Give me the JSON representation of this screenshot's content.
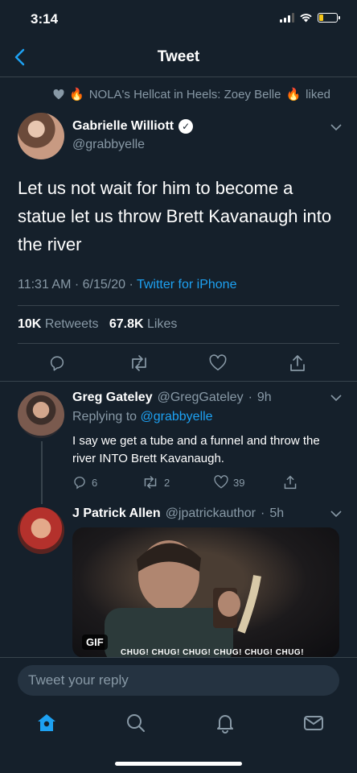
{
  "status_bar": {
    "time": "3:14"
  },
  "nav": {
    "title": "Tweet"
  },
  "liked_by": {
    "name": "NOLA's Hellcat in Heels: Zoey Belle",
    "action": "liked"
  },
  "tweet": {
    "author_name": "Gabrielle Williott",
    "author_handle": "@grabbyelle",
    "text": "Let us not wait for him to become a statue let us throw Brett Kavanaugh into the river",
    "time": "11:31 AM",
    "date": "6/15/20",
    "source": "Twitter for iPhone",
    "retweets_count": "10K",
    "retweets_label": "Retweets",
    "likes_count": "67.8K",
    "likes_label": "Likes"
  },
  "replies": [
    {
      "name": "Greg Gateley",
      "handle": "@GregGateley",
      "age": "9h",
      "replying_to_label": "Replying to",
      "replying_to": "@grabbyelle",
      "text": "I say we get a tube and a funnel and throw the river INTO Brett Kavanaugh.",
      "replies": "6",
      "retweets": "2",
      "likes": "39"
    },
    {
      "name": "J Patrick Allen",
      "handle": "@jpatrickauthor",
      "age": "5h",
      "gif_badge": "GIF",
      "gif_caption": "CHUG! CHUG! CHUG! CHUG! CHUG! CHUG!"
    }
  ],
  "composer": {
    "placeholder": "Tweet your reply"
  },
  "colors": {
    "background": "#15202b",
    "accent": "#1da1f2",
    "muted": "#8899a6",
    "divider": "#38444d"
  },
  "tabs": [
    "home-icon",
    "search-icon",
    "notifications-icon",
    "messages-icon"
  ]
}
